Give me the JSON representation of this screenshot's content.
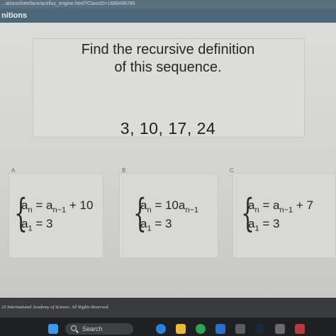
{
  "browser": {
    "url": "...ations/interface/acellus_engine.html?ClassID=1686496785"
  },
  "header": {
    "title": "nitions"
  },
  "question": {
    "line1": "Find the recursive definition",
    "line2": "of this sequence.",
    "sequence": "3, 10, 17, 24"
  },
  "options": [
    {
      "letter": "A",
      "eq1_left": "a",
      "eq1_left_sub": "n",
      "eq1_mid": " = a",
      "eq1_mid_sub": "n−1",
      "eq1_tail": " + 10",
      "eq2_left": "a",
      "eq2_left_sub": "1",
      "eq2_tail": " = 3"
    },
    {
      "letter": "B",
      "eq1_left": "a",
      "eq1_left_sub": "n",
      "eq1_mid": " = 10a",
      "eq1_mid_sub": "n−1",
      "eq1_tail": "",
      "eq2_left": "a",
      "eq2_left_sub": "1",
      "eq2_tail": " = 3"
    },
    {
      "letter": "C",
      "eq1_left": "a",
      "eq1_left_sub": "n",
      "eq1_mid": " = a",
      "eq1_mid_sub": "n−1",
      "eq1_tail": " + 7",
      "eq2_left": "a",
      "eq2_left_sub": "1",
      "eq2_tail": " = 3"
    }
  ],
  "footer": {
    "copyright": "23 International Academy of Science.  All Rights Reserved."
  },
  "taskbar": {
    "search_label": "Search"
  },
  "colors": {
    "panel_bg": "#d6d6d4",
    "titlebar": "#4c6878",
    "text": "#262626"
  }
}
